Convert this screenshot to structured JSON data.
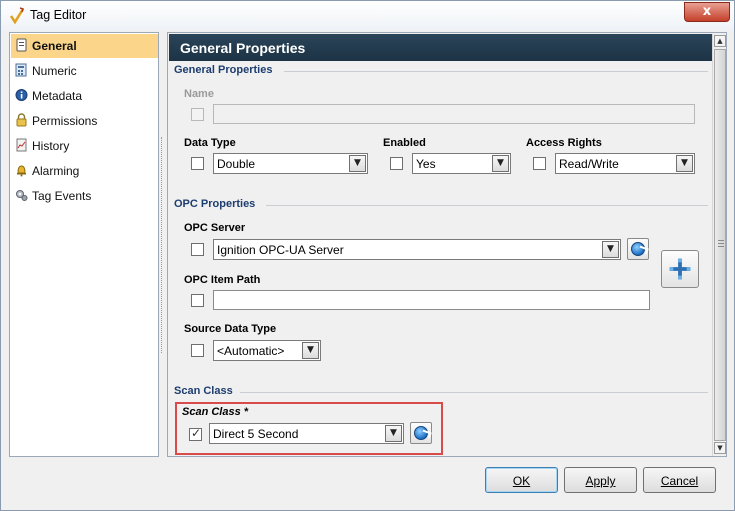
{
  "window": {
    "title": "Tag Editor",
    "close_glyph": "x"
  },
  "nav": {
    "items": [
      {
        "label": "General",
        "icon": "tag-icon"
      },
      {
        "label": "Numeric",
        "icon": "numeric-icon"
      },
      {
        "label": "Metadata",
        "icon": "info-icon"
      },
      {
        "label": "Permissions",
        "icon": "lock-icon"
      },
      {
        "label": "History",
        "icon": "history-icon"
      },
      {
        "label": "Alarming",
        "icon": "bell-icon"
      },
      {
        "label": "Tag Events",
        "icon": "gears-icon"
      }
    ],
    "selected": "General"
  },
  "panel": {
    "header": "General Properties",
    "general": {
      "section": "General Properties",
      "name_label": "Name",
      "name_value": "",
      "data_type_label": "Data Type",
      "data_type_value": "Double",
      "enabled_label": "Enabled",
      "enabled_value": "Yes",
      "access_label": "Access Rights",
      "access_value": "Read/Write"
    },
    "opc": {
      "section": "OPC Properties",
      "server_label": "OPC Server",
      "server_value": "Ignition OPC-UA Server",
      "item_path_label": "OPC Item Path",
      "item_path_value": "",
      "source_type_label": "Source Data Type",
      "source_type_value": "<Automatic>"
    },
    "scan": {
      "section": "Scan Class",
      "label": "Scan Class *",
      "value": "Direct 5 Second",
      "checked": true
    }
  },
  "buttons": {
    "ok": "OK",
    "apply": "Apply",
    "cancel": "Cancel"
  },
  "colors": {
    "header_bg": "#243c50",
    "nav_selected": "#fbd589",
    "highlight": "#d94b4b",
    "section_label": "#1c3d6e"
  }
}
